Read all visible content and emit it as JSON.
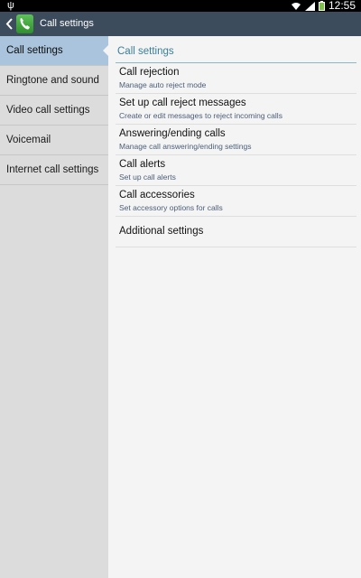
{
  "status_bar": {
    "time": "12:55"
  },
  "action_bar": {
    "title": "Call settings"
  },
  "left_menu": [
    {
      "label": "Call settings",
      "active": true
    },
    {
      "label": "Ringtone and sound"
    },
    {
      "label": "Video call settings"
    },
    {
      "label": "Voicemail"
    },
    {
      "label": "Internet call settings"
    }
  ],
  "right_panel": {
    "header": "Call settings",
    "items": [
      {
        "title": "Call rejection",
        "subtitle": "Manage auto reject mode"
      },
      {
        "title": "Set up call reject messages",
        "subtitle": "Create or edit messages to reject incoming calls"
      },
      {
        "title": "Answering/ending calls",
        "subtitle": "Manage call answering/ending settings"
      },
      {
        "title": "Call alerts",
        "subtitle": "Set up call alerts"
      },
      {
        "title": "Call accessories",
        "subtitle": "Set accessory options for calls"
      },
      {
        "title": "Additional settings"
      }
    ]
  },
  "colors": {
    "action_bar": "#3d4c5c",
    "active_item": "#a9c4dc",
    "accent": "#3a7f9a"
  }
}
